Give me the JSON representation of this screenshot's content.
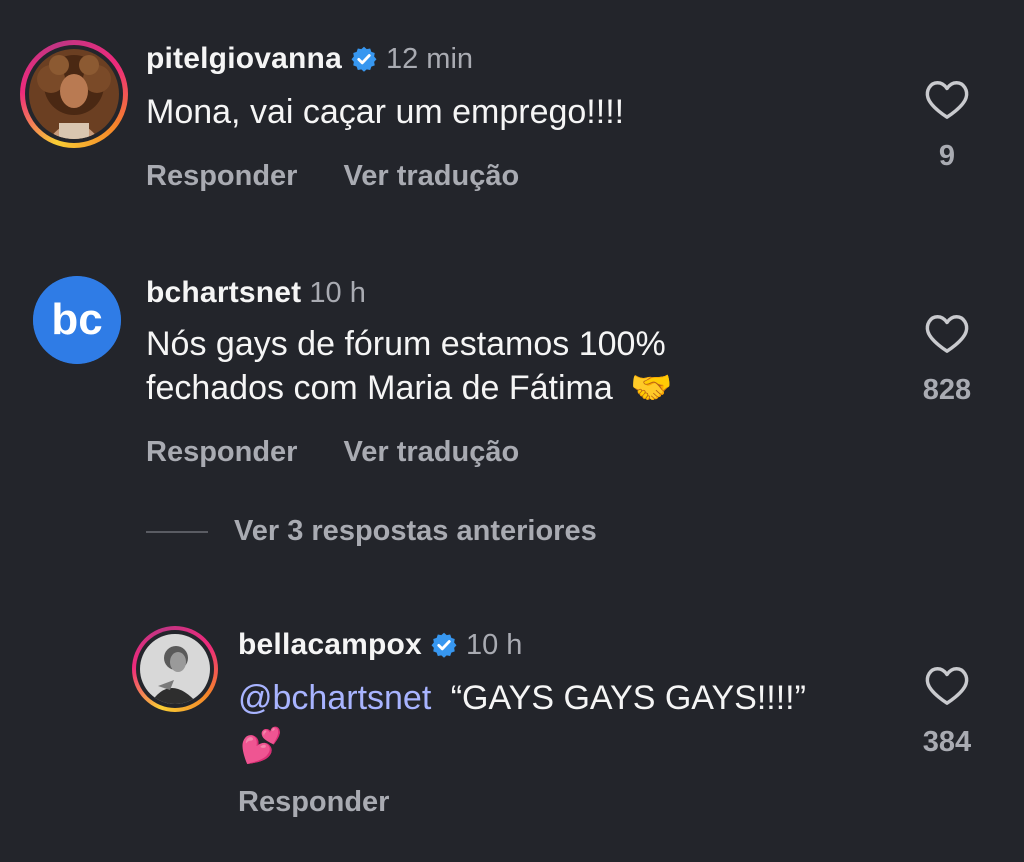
{
  "comments": [
    {
      "username": "pitelgiovanna",
      "verified": true,
      "time": "12 min",
      "text": "Mona, vai caçar um emprego!!!!",
      "reply_label": "Responder",
      "translate_label": "Ver tradução",
      "likes": "9"
    },
    {
      "username": "bchartsnet",
      "verified": false,
      "time": "10 h",
      "text_line1": "Nós gays de fórum estamos 100%",
      "text_line2": "fechados com Maria de Fátima",
      "emoji": "🤝",
      "avatar_text": "bc",
      "reply_label": "Responder",
      "translate_label": "Ver tradução",
      "likes": "828"
    }
  ],
  "view_replies_label": "Ver 3 respostas anteriores",
  "reply": {
    "username": "bellacampox",
    "verified": true,
    "time": "10 h",
    "mention": "@bchartsnet",
    "text": "“GAYS GAYS GAYS!!!!”",
    "emoji": "💕",
    "reply_label": "Responder",
    "likes": "384"
  },
  "colors": {
    "background": "#23252b",
    "secondary_text": "#a9abb2",
    "mention": "#a8b4ff",
    "verified_badge": "#3797f0",
    "bc_logo": "#2f7ce6"
  },
  "icons": {
    "verified": "verified-badge-icon",
    "like": "heart-outline-icon"
  }
}
